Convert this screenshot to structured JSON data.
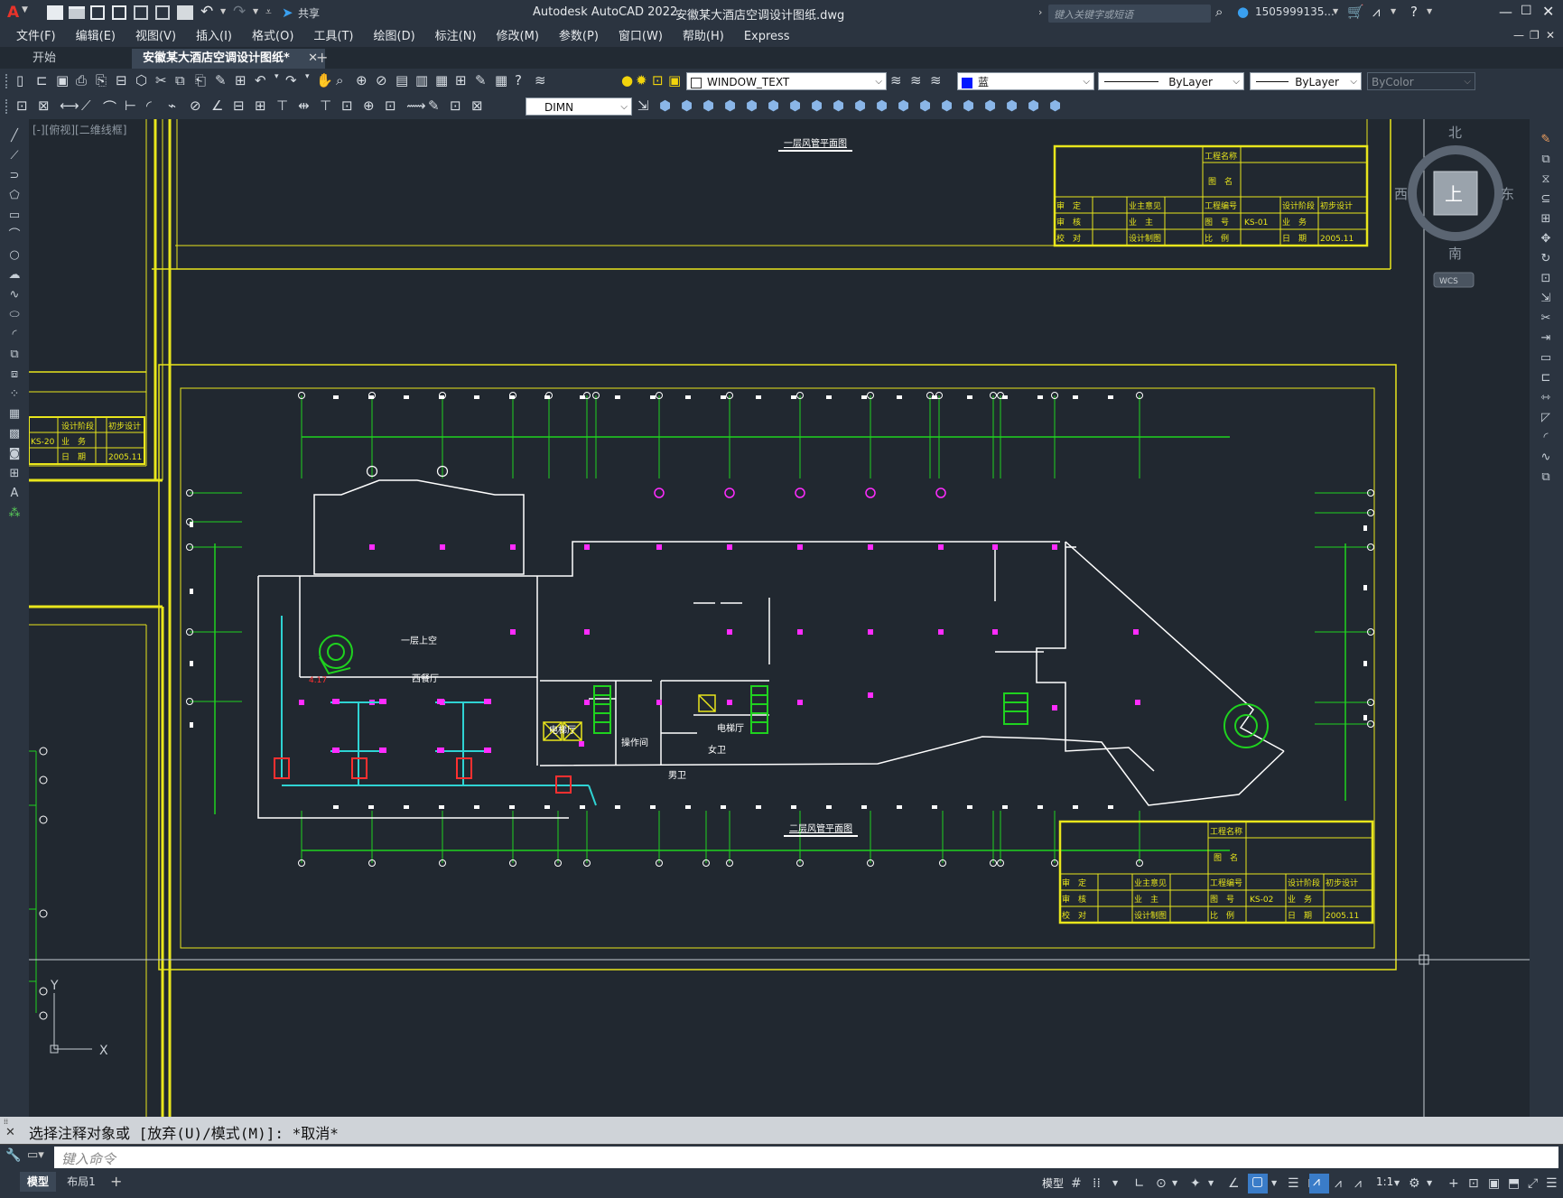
{
  "app": {
    "title": "Autodesk AutoCAD 2022",
    "document": "安徽某大酒店空调设计图纸.dwg",
    "search_placeholder": "键入关键字或短语",
    "user": "1505999135...",
    "logo": "A"
  },
  "menu": [
    "文件(F)",
    "编辑(E)",
    "视图(V)",
    "插入(I)",
    "格式(O)",
    "工具(T)",
    "绘图(D)",
    "标注(N)",
    "修改(M)",
    "参数(P)",
    "窗口(W)",
    "帮助(H)",
    "Express"
  ],
  "share_label": "共享",
  "tabs": [
    {
      "label": "开始",
      "active": false
    },
    {
      "label": "安徽某大酒店空调设计图纸*",
      "active": true
    }
  ],
  "toolbar": {
    "layer_name": "WINDOW_TEXT",
    "color_name": "蓝",
    "linetype": "ByLayer",
    "lineweight": "ByLayer",
    "plotstyle": "ByColor",
    "dimstyle": "DIMN"
  },
  "viewport_label": "[-][俯视][二维线框]",
  "viewcube": {
    "north": "北",
    "south": "南",
    "east": "东",
    "west": "西",
    "face": "上",
    "wcs": "WCS"
  },
  "ucs": {
    "x": "X",
    "y": "Y"
  },
  "drawing": {
    "sheet1_title": "一层风管平面图",
    "sheet2_title": "二层风管平面图",
    "titleblock_top": {
      "project_name": "工程名称",
      "drawing_name": "图　名",
      "r1": [
        "审　定",
        "业主意见",
        "工程编号",
        "设计阶段",
        "初步设计"
      ],
      "r2": [
        "审　核",
        "业　主",
        "图　号",
        "KS-01",
        "业　务"
      ],
      "r3": [
        "校　对",
        "设计制图",
        "比　例",
        "日　期",
        "2005.11"
      ]
    },
    "titleblock_left": {
      "r1": [
        "设计阶段",
        "初步设计"
      ],
      "r2": [
        "KS-20",
        "业　务"
      ],
      "r3": [
        "日　期",
        "2005.11"
      ]
    },
    "titleblock_bottom": {
      "project_name": "工程名称",
      "drawing_name": "图　名",
      "r1": [
        "审　定",
        "业主意见",
        "工程编号",
        "设计阶段",
        "初步设计"
      ],
      "r2": [
        "审　核",
        "业　主",
        "图　号",
        "KS-02",
        "业　务"
      ],
      "r3": [
        "校　对",
        "设计制图",
        "比　例",
        "日　期",
        "2005.11"
      ]
    },
    "rooms": {
      "void": "一层上空",
      "west_dining": "西餐厅",
      "elevator_hall_1": "电梯厅",
      "elevator_hall_2": "电梯厅",
      "operation": "操作间",
      "female_wc": "女卫",
      "male_wc": "男卫",
      "tag": "4.17"
    }
  },
  "command": {
    "history": "选择注释对象或 [放弃(U)/模式(M)]: *取消*",
    "placeholder": "键入命令"
  },
  "layout_tabs": [
    "模型",
    "布局1"
  ],
  "status": {
    "model": "模型",
    "scale": "1:1"
  },
  "colors": {
    "accent": "#e9e61c",
    "grid_green": "#1fd21f",
    "magenta": "#ff2cff",
    "cyan": "#2fd3d3"
  }
}
